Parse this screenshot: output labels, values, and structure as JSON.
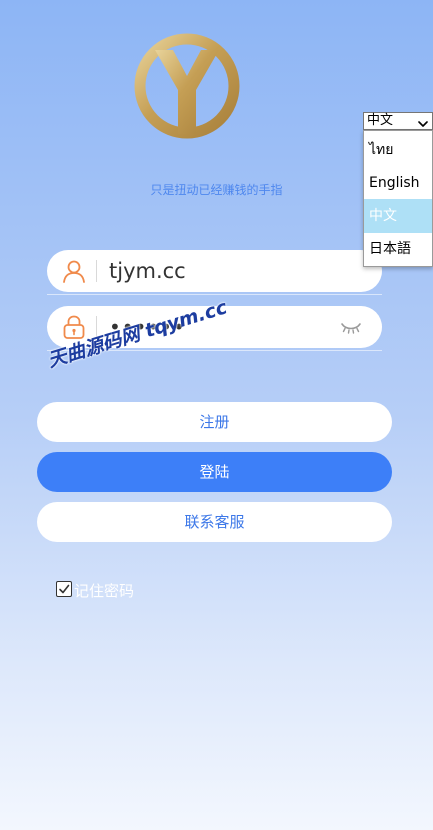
{
  "app": {
    "tagline": "只是扭动已经赚钱的手指"
  },
  "login": {
    "username_value": "tjym.cc",
    "password_value": "••••••",
    "register_label": "注册",
    "login_label": "登陆",
    "service_label": "联系客服",
    "remember_label": "记住密码",
    "remember_checked": true
  },
  "watermark": {
    "text": "天曲源码网 tqym.cc"
  },
  "language": {
    "selected": "中文",
    "options": [
      {
        "label": "ไทย"
      },
      {
        "label": "English"
      },
      {
        "label": "中文"
      },
      {
        "label": "日本語"
      }
    ]
  },
  "colors": {
    "primary": "#3d7ff8",
    "accent_orange": "#f08a4b",
    "gold": "#c9a45c",
    "dropdown_highlight": "#aee0f6"
  },
  "icons": {
    "logo": "y-gold-ring-logo",
    "user": "user-icon",
    "lock": "lock-icon",
    "eye": "eye-closed-icon",
    "check": "check-icon",
    "chevron": "chevron-down-icon"
  }
}
